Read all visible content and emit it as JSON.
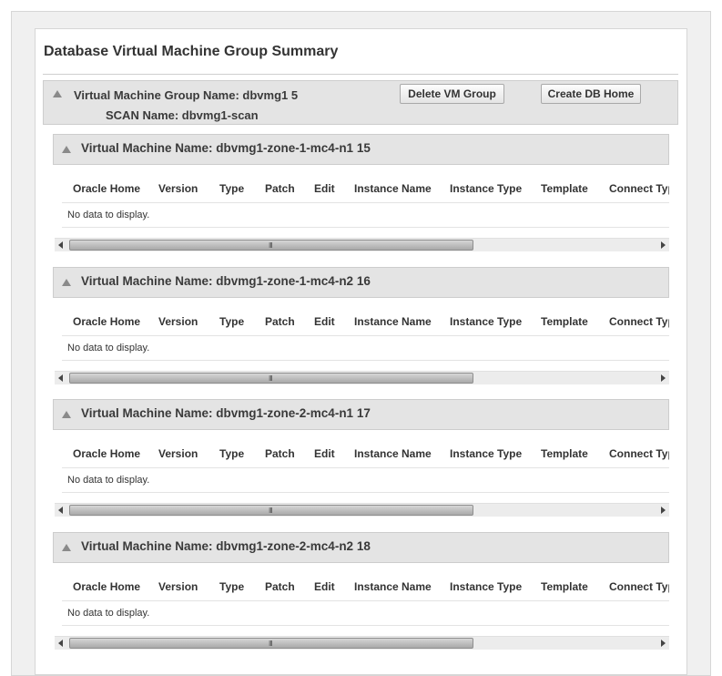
{
  "page": {
    "title": "Database Virtual Machine Group Summary"
  },
  "group": {
    "name_line": "Virtual Machine Group Name: dbvmg1 5",
    "scan_line": "SCAN Name: dbvmg1-scan",
    "delete_button": "Delete VM Group",
    "create_button": "Create DB Home"
  },
  "table": {
    "columns": [
      "Oracle Home",
      "Version",
      "Type",
      "Patch",
      "Edit",
      "Instance Name",
      "Instance Type",
      "Template",
      "Connect Typ"
    ],
    "empty_text": "No data to display.",
    "scroll_grip": "III"
  },
  "vms": [
    {
      "title": "Virtual Machine Name: dbvmg1-zone-1-mc4-n1 15"
    },
    {
      "title": "Virtual Machine Name: dbvmg1-zone-1-mc4-n2 16"
    },
    {
      "title": "Virtual Machine Name: dbvmg1-zone-2-mc4-n1 17"
    },
    {
      "title": "Virtual Machine Name: dbvmg1-zone-2-mc4-n2 18"
    }
  ],
  "icons": {
    "expand": "triangle-down-icon",
    "scroll_left": "arrow-left-icon",
    "scroll_right": "arrow-right-icon"
  }
}
